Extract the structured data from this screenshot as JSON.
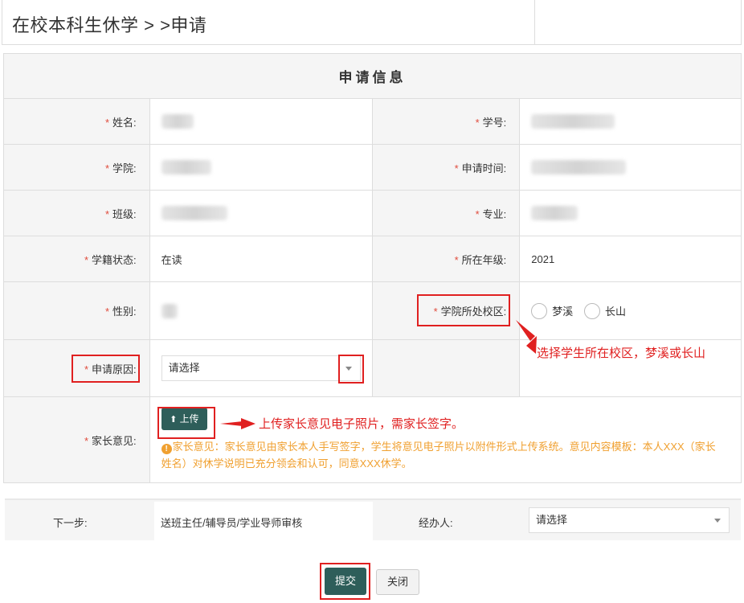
{
  "page": {
    "title": "在校本科生休学 > >申请"
  },
  "form": {
    "header": "申请信息",
    "fields": {
      "name": {
        "label": "姓名:"
      },
      "student_id": {
        "label": "学号:"
      },
      "college": {
        "label": "学院:"
      },
      "apply_time": {
        "label": "申请时间:"
      },
      "class": {
        "label": "班级:"
      },
      "major": {
        "label": "专业:"
      },
      "status": {
        "label": "学籍状态:",
        "value": "在读"
      },
      "grade": {
        "label": "所在年级:",
        "value": "2021"
      },
      "gender": {
        "label": "性别:"
      },
      "campus": {
        "label": "学院所处校区:",
        "options": [
          "梦溪",
          "长山"
        ]
      },
      "reason": {
        "label": "申请原因:",
        "placeholder": "请选择"
      },
      "parent_opinion": {
        "label": "家长意见:",
        "upload_label": "上传",
        "note": "家长意见：家长意见由家长本人手写签字，学生将意见电子照片以附件形式上传系统。意见内容模板：本人XXX（家长姓名）对休学说明已充分领会和认可，同意XXX休学。"
      }
    }
  },
  "annotations": {
    "campus_hint": "选择学生所在校区，梦溪或长山",
    "upload_hint": "上传家长意见电子照片，需家长签字。"
  },
  "next_step": {
    "label": "下一步:",
    "value": "送班主任/辅导员/学业导师审核",
    "handler_label": "经办人:",
    "handler_placeholder": "请选择"
  },
  "actions": {
    "submit": "提交",
    "close": "关闭"
  },
  "colors": {
    "required": "#e04b3c",
    "primary_button": "#2e5e5a",
    "annotation": "#e02020",
    "note": "#f0a030"
  }
}
